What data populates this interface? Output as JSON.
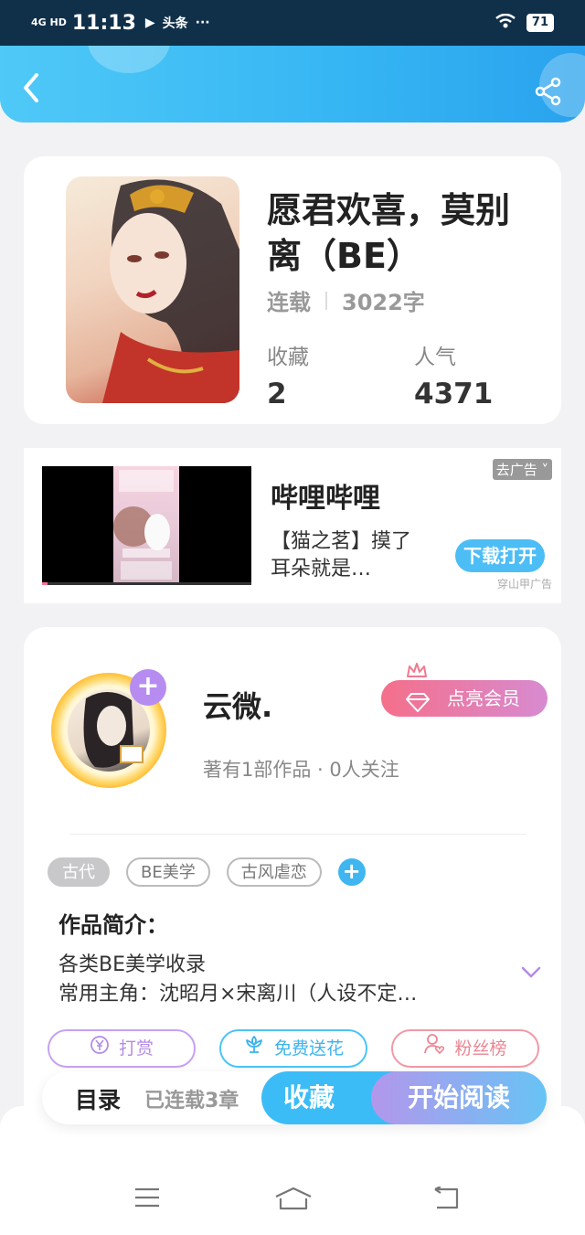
{
  "status_bar": {
    "network": "4G HD",
    "time": "11:13",
    "notif": "头条",
    "dots": "···",
    "battery": "71"
  },
  "book": {
    "title": "愿君欢喜，莫别离（BE）",
    "status": "连载",
    "word_count": "3022字",
    "fav_label": "收藏",
    "fav_value": "2",
    "pop_label": "人气",
    "pop_value": "4371"
  },
  "ad": {
    "title": "哔哩哔哩",
    "desc": "【猫之茗】摸了耳朵就是…",
    "close_label": "去广告",
    "download_label": "下载打开",
    "source": "穿山甲广告"
  },
  "author": {
    "name": "云微.",
    "stats": "著有1部作品 · 0人关注",
    "vip_label": "点亮会员",
    "follow_plus": "+"
  },
  "tags": [
    "古代",
    "BE美学",
    "古风虐恋"
  ],
  "intro": {
    "title": "作品简介：",
    "line1": "各类BE美学收录",
    "line2": "常用主角：沈昭月×宋离川（人设不定…"
  },
  "actions": {
    "reward": "打赏",
    "flower": "免费送花",
    "fans": "粉丝榜"
  },
  "bottom": {
    "toc": "目录",
    "chapters": "已连载3章",
    "fav": "收藏",
    "read": "开始阅读"
  },
  "colors": {
    "header": "#35b5f3",
    "accent_purple": "#b68cf0",
    "vip_pink": "#f56f8a"
  }
}
